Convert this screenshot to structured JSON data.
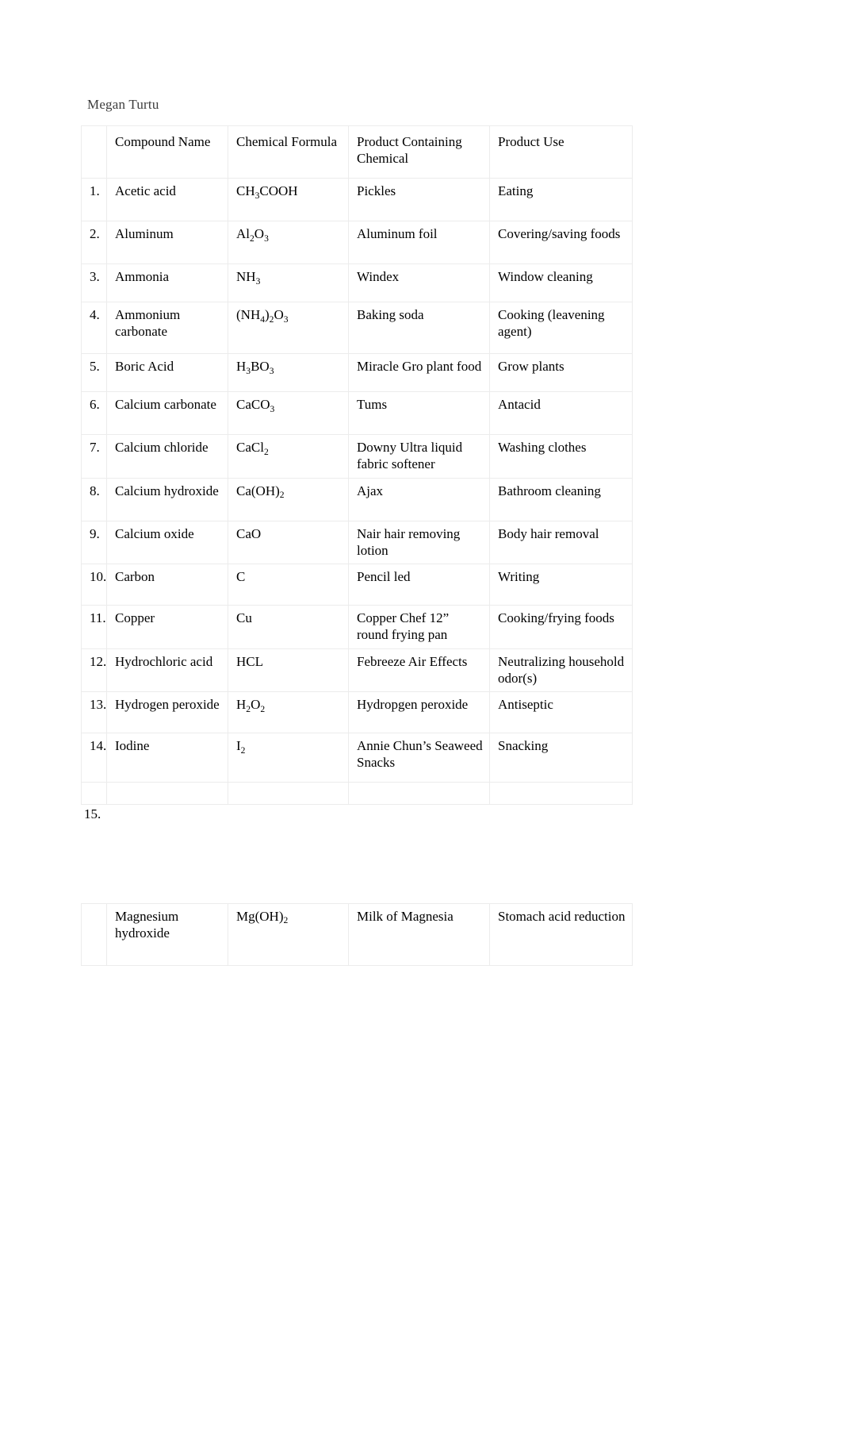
{
  "document": {
    "author": "Megan Turtu",
    "orphan_item_number": "15."
  },
  "table": {
    "headers": {
      "num": "",
      "compound_name": "Compound Name",
      "chemical_formula": "Chemical Formula",
      "product_containing_chemical": "Product Containing Chemical",
      "product_use": "Product Use"
    },
    "rows": [
      {
        "num": "1.",
        "name": "Acetic acid",
        "formula_base": "CH",
        "formula_sub": "3",
        "formula_tail": "COOH",
        "formula_plain": "CH3COOH",
        "product": "Pickles",
        "use": "Eating"
      },
      {
        "num": "2.",
        "name": "Aluminum",
        "formula_plain": "Al2O3",
        "product": "Aluminum foil",
        "use": "Covering/saving foods"
      },
      {
        "num": "3.",
        "name": "Ammonia",
        "formula_plain": "NH3",
        "product": "Windex",
        "use": "Window cleaning"
      },
      {
        "num": "4.",
        "name": "Ammonium carbonate",
        "formula_plain": "(NH4)2O3",
        "product": "Baking soda",
        "use": "Cooking (leavening agent)"
      },
      {
        "num": "5.",
        "name": "Boric Acid",
        "formula_plain": "H3BO3",
        "product": "Miracle Gro plant food",
        "use": "Grow plants"
      },
      {
        "num": "6.",
        "name": "Calcium carbonate",
        "formula_plain": "CaCO3",
        "product": "Tums",
        "use": "Antacid"
      },
      {
        "num": "7.",
        "name": "Calcium chloride",
        "formula_plain": "CaCl2",
        "product": "Downy Ultra liquid fabric softener",
        "use": "Washing clothes"
      },
      {
        "num": "8.",
        "name": "Calcium hydroxide",
        "formula_plain": "Ca(OH)2",
        "product": "Ajax",
        "use": "Bathroom cleaning"
      },
      {
        "num": "9.",
        "name": "Calcium oxide",
        "formula_plain": "CaO",
        "product": "Nair hair removing lotion",
        "use": "Body hair removal"
      },
      {
        "num": "10.",
        "name": "Carbon",
        "formula_plain": "C",
        "product": "Pencil led",
        "use": "Writing"
      },
      {
        "num": "11.",
        "name": "Copper",
        "formula_plain": "Cu",
        "product": "Copper Chef 12” round frying pan",
        "use": "Cooking/frying foods"
      },
      {
        "num": "12.",
        "name": "Hydrochloric acid",
        "formula_plain": "HCL",
        "product": "Febreeze Air Effects",
        "use": "Neutralizing household odor(s)"
      },
      {
        "num": "13.",
        "name": "Hydrogen peroxide",
        "formula_plain": "H2O2",
        "product": "Hydropgen peroxide",
        "use": "Antiseptic"
      },
      {
        "num": "14.",
        "name": "Iodine",
        "formula_plain": "I2",
        "product": "Annie Chun’s Seaweed Snacks",
        "use": "Snacking"
      }
    ],
    "second_table_rows": [
      {
        "num": "",
        "name": "Magnesium hydroxide",
        "formula_plain": "Mg(OH)2",
        "product": "Milk of Magnesia",
        "use": "Stomach acid reduction"
      }
    ]
  },
  "formula_markup": {
    "1": "CH<sub>3</sub>COOH",
    "2": "Al<sub>2</sub>O<sub>3</sub>",
    "3": "NH<sub>3</sub>",
    "4": "(NH<sub>4</sub>)<sub>2</sub>O<sub>3</sub>",
    "5": "H<sub>3</sub>BO<sub>3</sub>",
    "6": "CaCO<sub>3</sub>",
    "7": "CaCl<sub>2</sub>",
    "8": "Ca(OH)<sub>2</sub>",
    "9": "CaO",
    "10": "C",
    "11": "Cu",
    "12": "HCL",
    "13": "H<sub>2</sub>O<sub>2</sub>",
    "14": "I<sub>2</sub>",
    "15": "Mg(OH)<sub>2</sub>"
  },
  "colors": {
    "page_background": "#ffffff",
    "text": "#000000",
    "author_text": "#3d3d3d",
    "cell_border": "#ececec"
  }
}
